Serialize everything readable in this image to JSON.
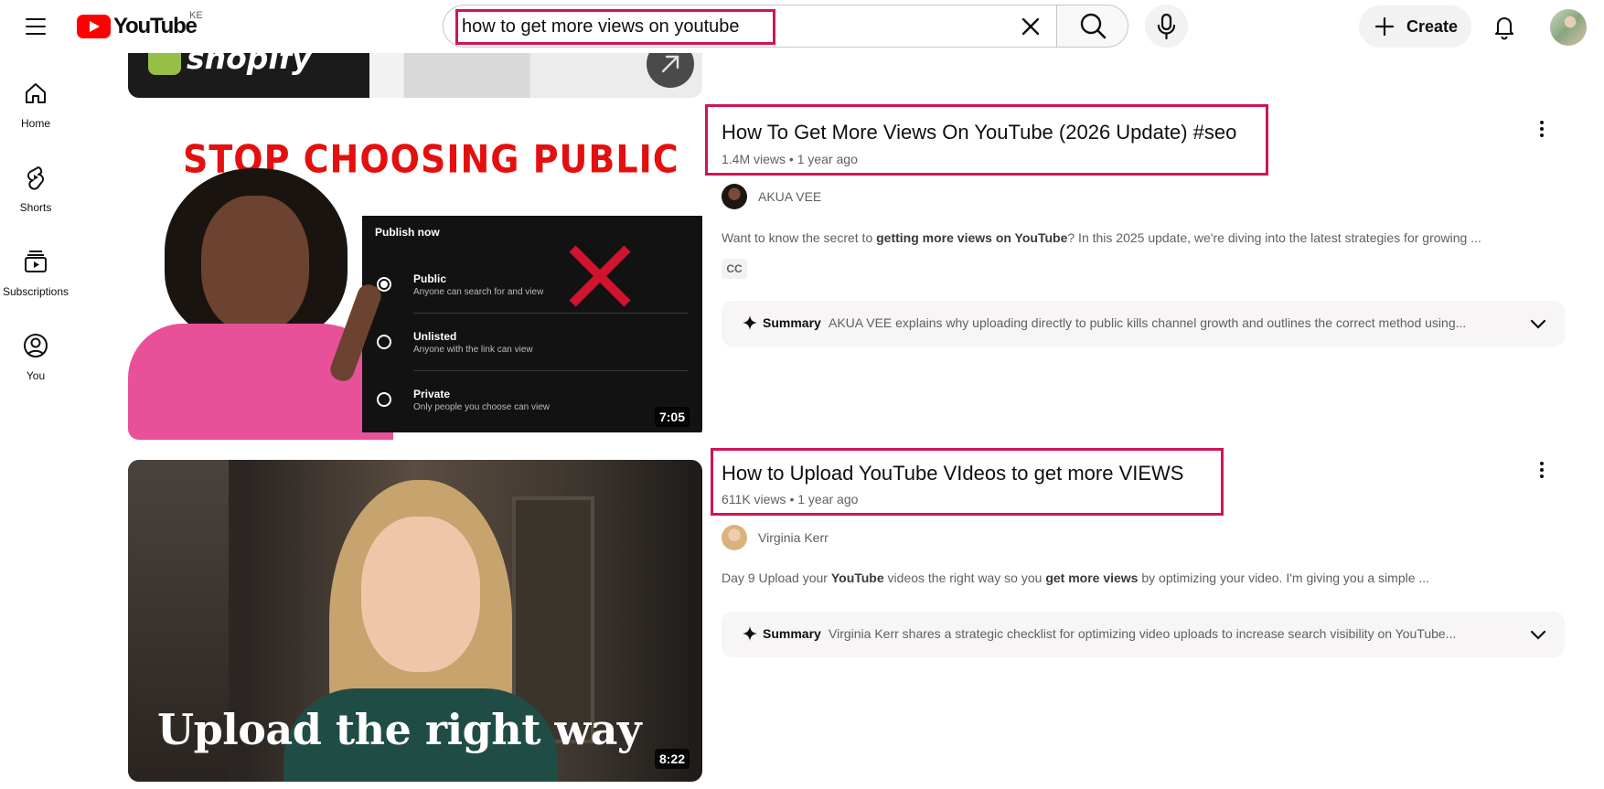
{
  "header": {
    "logo_text": "YouTube",
    "country_code": "KE",
    "search": {
      "query": "how to get more views on youtube"
    },
    "create_label": "Create"
  },
  "sidebar": {
    "items": [
      {
        "label": "Home",
        "icon": "home-icon"
      },
      {
        "label": "Shorts",
        "icon": "shorts-icon"
      },
      {
        "label": "Subscriptions",
        "icon": "subscriptions-icon"
      },
      {
        "label": "You",
        "icon": "you-icon"
      }
    ]
  },
  "results": [
    {
      "thumbnail": {
        "headline": "STOP CHOOSING PUBLIC",
        "panel_title": "Publish now",
        "options": [
          {
            "title": "Public",
            "sub": "Anyone can search for and view"
          },
          {
            "title": "Unlisted",
            "sub": "Anyone with the link can view"
          },
          {
            "title": "Private",
            "sub": "Only people you choose can view"
          }
        ],
        "duration": "7:05"
      },
      "title": "How To Get More Views On YouTube (2026 Update) #seo",
      "views": "1.4M views",
      "age": "1 year ago",
      "channel": "AKUA VEE",
      "description_parts": [
        "Want to know the secret to ",
        "getting more views on YouTube",
        "? In this 2025 update, we're diving into the latest strategies for growing ..."
      ],
      "badge": "CC",
      "summary_label": "Summary",
      "summary_text": "AKUA VEE explains why uploading directly to public kills channel growth and outlines the correct method using..."
    },
    {
      "thumbnail": {
        "caption": "Upload the right way",
        "duration": "8:22"
      },
      "title": "How to Upload YouTube VIdeos to get more VIEWS",
      "views": "611K views",
      "age": "1 year ago",
      "channel": "Virginia Kerr",
      "description_parts": [
        "Day 9 Upload your ",
        "YouTube",
        " videos the right way so you ",
        "get more views",
        " by optimizing your video. I'm giving you a simple ..."
      ],
      "summary_label": "Summary",
      "summary_text": "Virginia Kerr shares a strategic checklist for optimizing video uploads to increase search visibility on YouTube..."
    }
  ],
  "partial_thumbnail": {
    "brand_text": "shopify"
  },
  "colors": {
    "brand_red": "#ff0000",
    "highlight": "#d0145a",
    "thumb_headline": "#e3100f"
  }
}
